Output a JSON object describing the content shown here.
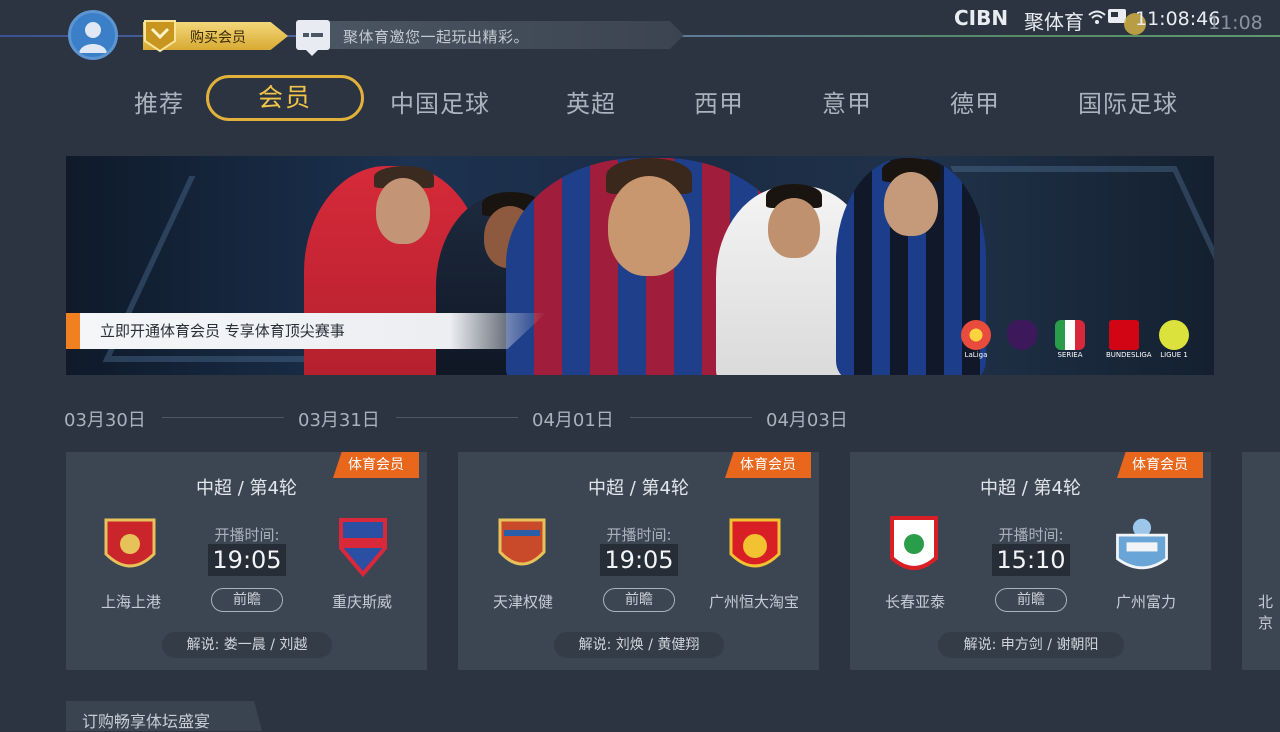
{
  "header": {
    "vip_button_label": "购买会员",
    "message_text": "聚体育邀您一起玩出精彩。",
    "brand_cibn": "CIBN",
    "brand_name": "聚体育",
    "clock": "11:08:46",
    "clock_ghost": "11:08"
  },
  "tabs": [
    {
      "label": "推荐"
    },
    {
      "label": "会员",
      "active": true
    },
    {
      "label": "中国足球"
    },
    {
      "label": "英超"
    },
    {
      "label": "西甲"
    },
    {
      "label": "意甲"
    },
    {
      "label": "德甲"
    },
    {
      "label": "国际足球"
    }
  ],
  "banner": {
    "caption": "立即开通体育会员 专享体育顶尖赛事",
    "league_logos": [
      {
        "label": "LaLiga",
        "color": "#e94b3c"
      },
      {
        "label": "",
        "color": "#3d195b"
      },
      {
        "label": "SERIEA",
        "color": "#2a9d4a"
      },
      {
        "label": "BUNDESLIGA",
        "color": "#d20515"
      },
      {
        "label": "LIGUE 1",
        "color": "#dbe23b"
      }
    ]
  },
  "dates": [
    "03月30日",
    "03月31日",
    "04月01日",
    "04月03日"
  ],
  "matches": [
    {
      "badge": "体育会员",
      "league": "中超 / 第4轮",
      "home": "上海上港",
      "away": "重庆斯威",
      "start_label": "开播时间:",
      "time": "19:05",
      "preview": "前瞻",
      "commentary": "解说: 娄一晨 / 刘越",
      "home_color": "#c9252b",
      "away_color": "#2a4fa3"
    },
    {
      "badge": "体育会员",
      "league": "中超 / 第4轮",
      "home": "天津权健",
      "away": "广州恒大淘宝",
      "start_label": "开播时间:",
      "time": "19:05",
      "preview": "前瞻",
      "commentary": "解说: 刘焕 / 黄健翔",
      "home_color": "#c94a2a",
      "away_color": "#d81f26"
    },
    {
      "badge": "体育会员",
      "league": "中超 / 第4轮",
      "home": "长春亚泰",
      "away": "广州富力",
      "start_label": "开播时间:",
      "time": "15:10",
      "preview": "前瞻",
      "commentary": "解说: 申方剑 / 谢朝阳",
      "home_color": "#d81f26",
      "away_color": "#6aa5d8"
    }
  ],
  "next_card_partial": "北京",
  "bottom_section": "订购畅享体坛盛宴",
  "accent_color": "#e0b23b",
  "badge_color": "#e8671c"
}
